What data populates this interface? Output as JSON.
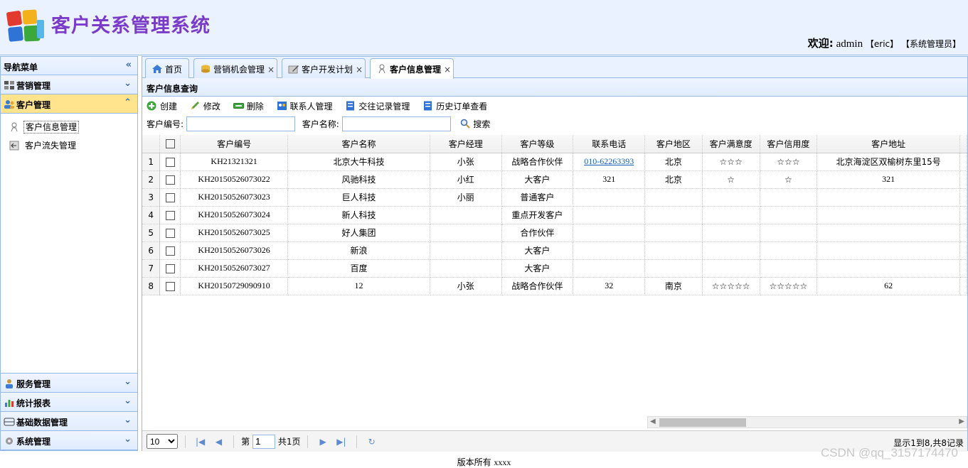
{
  "header": {
    "app_title": "客户关系管理系统",
    "welcome_label": "欢迎:",
    "username": "admin",
    "user_realname": "【eric】",
    "user_role": "【系统管理员】"
  },
  "sidebar": {
    "title": "导航菜单",
    "collapse_icon": "«",
    "sections": [
      {
        "label": "营销管理",
        "icon": "grid-icon"
      },
      {
        "label": "客户管理",
        "icon": "users-icon",
        "selected": true
      },
      {
        "label": "服务管理",
        "icon": "service-icon"
      },
      {
        "label": "统计报表",
        "icon": "chart-icon"
      },
      {
        "label": "基础数据管理",
        "icon": "database-icon"
      },
      {
        "label": "系统管理",
        "icon": "gear-icon"
      }
    ],
    "sub_items": [
      {
        "label": "客户信息管理",
        "selected": true
      },
      {
        "label": "客户流失管理"
      }
    ]
  },
  "tabs": [
    {
      "label": "首页",
      "icon": "home-icon"
    },
    {
      "label": "营销机会管理",
      "icon": "coins-icon",
      "closable": true
    },
    {
      "label": "客户开发计划",
      "icon": "pencil-icon",
      "closable": true
    },
    {
      "label": "客户信息管理",
      "icon": "customer-icon",
      "closable": true,
      "selected": true
    }
  ],
  "panel": {
    "title": "客户信息查询"
  },
  "toolbar": {
    "create": "创建",
    "edit": "修改",
    "delete": "删除",
    "contacts": "联系人管理",
    "interactions": "交往记录管理",
    "orders": "历史订单查看"
  },
  "search": {
    "code_label": "客户编号:",
    "code_value": "",
    "name_label": "客户名称:",
    "name_value": "",
    "button": "搜索"
  },
  "table": {
    "columns": [
      "客户编号",
      "客户名称",
      "客户经理",
      "客户等级",
      "联系电话",
      "客户地区",
      "客户满意度",
      "客户信用度",
      "客户地址"
    ],
    "rows": [
      {
        "no": "1",
        "code": "KH21321321",
        "name": "北京大牛科技",
        "manager": "小张",
        "level": "战略合作伙伴",
        "phone": "010-62263393",
        "region": "北京",
        "satisfaction": "☆☆☆",
        "credit": "☆☆☆",
        "address": "北京海淀区双榆树东里15号"
      },
      {
        "no": "2",
        "code": "KH20150526073022",
        "name": "风驰科技",
        "manager": "小红",
        "level": "大客户",
        "phone": "321",
        "region": "北京",
        "satisfaction": "☆",
        "credit": "☆",
        "address": "321"
      },
      {
        "no": "3",
        "code": "KH20150526073023",
        "name": "巨人科技",
        "manager": "小丽",
        "level": "普通客户",
        "phone": "",
        "region": "",
        "satisfaction": "",
        "credit": "",
        "address": ""
      },
      {
        "no": "4",
        "code": "KH20150526073024",
        "name": "新人科技",
        "manager": "",
        "level": "重点开发客户",
        "phone": "",
        "region": "",
        "satisfaction": "",
        "credit": "",
        "address": ""
      },
      {
        "no": "5",
        "code": "KH20150526073025",
        "name": "好人集团",
        "manager": "",
        "level": "合作伙伴",
        "phone": "",
        "region": "",
        "satisfaction": "",
        "credit": "",
        "address": ""
      },
      {
        "no": "6",
        "code": "KH20150526073026",
        "name": "新浪",
        "manager": "",
        "level": "大客户",
        "phone": "",
        "region": "",
        "satisfaction": "",
        "credit": "",
        "address": ""
      },
      {
        "no": "7",
        "code": "KH20150526073027",
        "name": "百度",
        "manager": "",
        "level": "大客户",
        "phone": "",
        "region": "",
        "satisfaction": "",
        "credit": "",
        "address": ""
      },
      {
        "no": "8",
        "code": "KH20150729090910",
        "name": "12",
        "manager": "小张",
        "level": "战略合作伙伴",
        "phone": "32",
        "region": "南京",
        "satisfaction": "☆☆☆☆☆",
        "credit": "☆☆☆☆☆",
        "address": "62"
      }
    ]
  },
  "pager": {
    "page_size": "10",
    "page_prefix": "第",
    "page_value": "1",
    "page_suffix": "共1页",
    "info": "显示1到8,共8记录"
  },
  "footer": {
    "prefix": "版本所有",
    "suffix": "xxxx"
  },
  "watermark": "CSDN @qq_3157174470",
  "colors": {
    "header_bg": "#eaf2ff",
    "border": "#95b8e7",
    "selected_section": "#ffe48d",
    "title_purple": "#7a3cc8",
    "link_blue": "#1a5fb4"
  }
}
